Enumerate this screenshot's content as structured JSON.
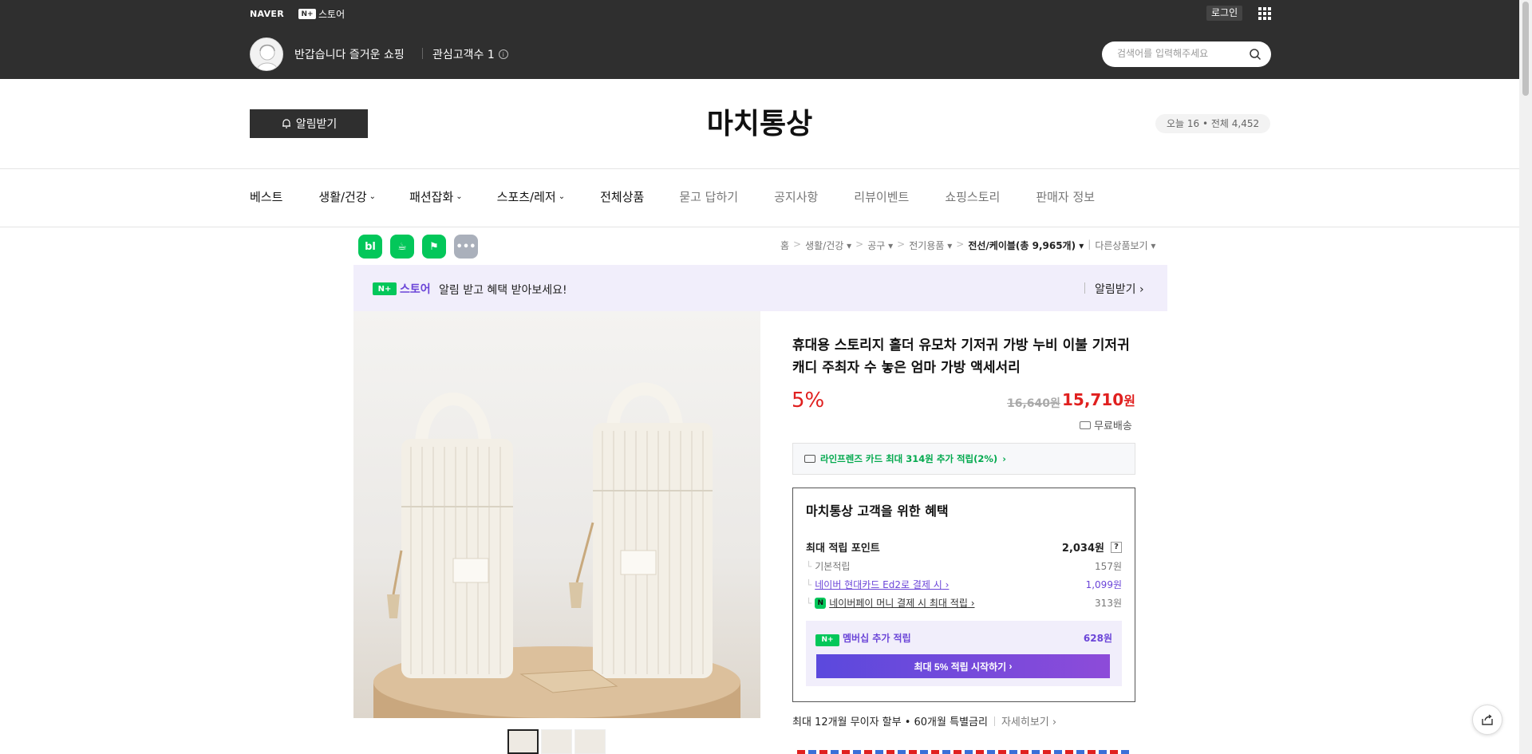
{
  "topbar": {
    "naver_logo": "NAVER",
    "nplus_label": "스토어",
    "nplus_badge": "N+",
    "login": "로그인",
    "greeting": "반갑습니다 즐거운 쇼핑",
    "fav_label": "관심고객수 1",
    "search_placeholder": "검색어를 입력해주세요"
  },
  "store": {
    "alarm_button": "알림받기",
    "title": "마치통상",
    "visit": "오늘 16 • 전체 4,452"
  },
  "nav": [
    {
      "label": "베스트",
      "style": "dark",
      "chevron": false
    },
    {
      "label": "생활/건강",
      "style": "dark",
      "chevron": true
    },
    {
      "label": "패션잡화",
      "style": "dark",
      "chevron": true
    },
    {
      "label": "스포츠/레저",
      "style": "dark",
      "chevron": true
    },
    {
      "label": "전체상품",
      "style": "dark",
      "chevron": false
    },
    {
      "label": "묻고 답하기",
      "style": "light",
      "chevron": false
    },
    {
      "label": "공지사항",
      "style": "light",
      "chevron": false
    },
    {
      "label": "리뷰이벤트",
      "style": "light",
      "chevron": false
    },
    {
      "label": "쇼핑스토리",
      "style": "light",
      "chevron": false
    },
    {
      "label": "판매자 정보",
      "style": "light",
      "chevron": false
    }
  ],
  "share_icons": [
    "blog",
    "cafe",
    "band",
    "more"
  ],
  "breadcrumb": {
    "home": "홈",
    "c1": "생활/건강",
    "c2": "공구",
    "c3": "전기용품",
    "current": "전선/케이블(총 9,965개)",
    "other": "다른상품보기"
  },
  "banner": {
    "brand": "스토어",
    "badge": "N+",
    "message": "알림 받고 혜택 받아보세요!",
    "action": "알림받기"
  },
  "product": {
    "title": "휴대용 스토리지 홀더 유모차 기저귀 가방 누비 이불 기저귀 캐디 주최자 수 놓은 엄마 가방 액세서리",
    "discount": "5%",
    "original_price": "16,640원",
    "price": "15,710",
    "price_unit": "원",
    "shipping": "무료배송",
    "card_offer": "라인프렌즈 카드 최대 314원 추가 적립(2%)",
    "thumbnails": 3
  },
  "benefit": {
    "title": "마치통상 고객을 위한 혜택",
    "max_point_label": "최대 적립 포인트",
    "max_point_value": "2,034원",
    "base_label": "기본적립",
    "base_value": "157원",
    "card_label": "네이버 현대카드 Ed2로 결제 시",
    "card_value": "1,099원",
    "npay_label": "네이버페이 머니 결제 시 최대 적립",
    "npay_value": "313원",
    "member_label": "멤버십 추가 적립",
    "member_value": "628원",
    "member_button": "최대 5% 적립 시작하기"
  },
  "installment": {
    "text": "최대 12개월 무이자 할부 • 60개월 특별금리",
    "more": "자세히보기"
  },
  "colors": {
    "topbar": "#2f2f2f",
    "naver_green": "#03c75a",
    "price_red": "#e0201f",
    "membership_purple": "#6b45d8"
  }
}
